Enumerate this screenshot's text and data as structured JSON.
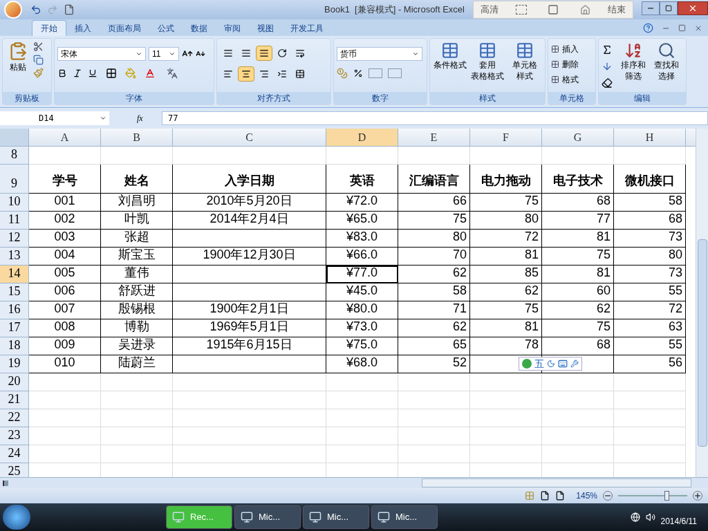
{
  "title_bar": {
    "title": "Book1  [兼容模式] - Microsoft Excel",
    "recorder_hd": "高清",
    "recorder_end": "结束"
  },
  "ribbon_tabs": [
    {
      "label": "开始",
      "selected": true
    },
    {
      "label": "插入",
      "selected": false
    },
    {
      "label": "页面布局",
      "selected": false
    },
    {
      "label": "公式",
      "selected": false
    },
    {
      "label": "数据",
      "selected": false
    },
    {
      "label": "审阅",
      "selected": false
    },
    {
      "label": "视图",
      "selected": false
    },
    {
      "label": "开发工具",
      "selected": false
    }
  ],
  "clipboard": {
    "paste": "粘贴",
    "label": "剪贴板"
  },
  "font": {
    "name": "宋体",
    "size": "11",
    "label": "字体"
  },
  "alignment": {
    "label": "对齐方式",
    "vertical": [
      {
        "selected": false
      },
      {
        "selected": false
      },
      {
        "selected": true
      }
    ],
    "horizontal": [
      {
        "selected": false
      },
      {
        "selected": true
      },
      {
        "selected": false
      }
    ]
  },
  "number": {
    "format": "货币",
    "label": "数字"
  },
  "styles": {
    "label": "样式",
    "buttons": [
      {
        "line1": "条件格式"
      },
      {
        "line1": "套用",
        "line2": "表格格式"
      },
      {
        "line1": "单元格",
        "line2": "样式"
      }
    ]
  },
  "cells": {
    "label": "单元格",
    "buttons": [
      "插入",
      "删除",
      "格式"
    ]
  },
  "editing": {
    "label": "编辑",
    "buttons": [
      {
        "line1": "排序和",
        "line2": "筛选"
      },
      {
        "line1": "查找和",
        "line2": "选择"
      }
    ]
  },
  "formula_bar": {
    "name_box": "D14",
    "fx": "fx",
    "formula": "77"
  },
  "columns": [
    {
      "label": "A",
      "selected": false
    },
    {
      "label": "B",
      "selected": false
    },
    {
      "label": "C",
      "selected": false
    },
    {
      "label": "D",
      "selected": true
    },
    {
      "label": "E",
      "selected": false
    },
    {
      "label": "F",
      "selected": false
    },
    {
      "label": "G",
      "selected": false
    },
    {
      "label": "H",
      "selected": false
    }
  ],
  "rows": [
    {
      "number": "8",
      "kind": "empty",
      "selected": false
    },
    {
      "number": "9",
      "kind": "header",
      "selected": false,
      "cells": [
        "学号",
        "姓名",
        "入学日期",
        "英语",
        "汇编语言",
        "电力拖动",
        "电子技术",
        "微机接口"
      ]
    },
    {
      "number": "10",
      "kind": "data",
      "selected": false,
      "cells": [
        "001",
        "刘昌明",
        "2010年5月20日",
        "¥72.0",
        "66",
        "75",
        "68",
        "58"
      ]
    },
    {
      "number": "11",
      "kind": "data",
      "selected": false,
      "cells": [
        "002",
        "叶凯",
        "2014年2月4日",
        "¥65.0",
        "75",
        "80",
        "77",
        "68"
      ]
    },
    {
      "number": "12",
      "kind": "data",
      "selected": false,
      "cells": [
        "003",
        "张超",
        "",
        "¥83.0",
        "80",
        "72",
        "81",
        "73"
      ]
    },
    {
      "number": "13",
      "kind": "data",
      "selected": false,
      "cells": [
        "004",
        "斯宝玉",
        "1900年12月30日",
        "¥66.0",
        "70",
        "81",
        "75",
        "80"
      ]
    },
    {
      "number": "14",
      "kind": "data",
      "selected": true,
      "cells": [
        "005",
        "董伟",
        "",
        "¥77.0",
        "62",
        "85",
        "81",
        "73"
      ]
    },
    {
      "number": "15",
      "kind": "data",
      "selected": false,
      "cells": [
        "006",
        "舒跃进",
        "",
        "¥45.0",
        "58",
        "62",
        "60",
        "55"
      ]
    },
    {
      "number": "16",
      "kind": "data",
      "selected": false,
      "cells": [
        "007",
        "殷锡根",
        "1900年2月1日",
        "¥80.0",
        "71",
        "75",
        "62",
        "72"
      ]
    },
    {
      "number": "17",
      "kind": "data",
      "selected": false,
      "cells": [
        "008",
        "博勒",
        "1969年5月1日",
        "¥73.0",
        "62",
        "81",
        "75",
        "63"
      ]
    },
    {
      "number": "18",
      "kind": "data",
      "selected": false,
      "cells": [
        "009",
        "吴进录",
        "1915年6月15日",
        "¥75.0",
        "65",
        "78",
        "68",
        "55"
      ]
    },
    {
      "number": "19",
      "kind": "data",
      "selected": false,
      "cells": [
        "010",
        "陆蔚兰",
        "",
        "¥68.0",
        "52",
        "",
        "",
        "56"
      ]
    },
    {
      "number": "20",
      "kind": "empty",
      "selected": false
    },
    {
      "number": "21",
      "kind": "empty",
      "selected": false
    },
    {
      "number": "22",
      "kind": "empty",
      "selected": false
    },
    {
      "number": "23",
      "kind": "empty",
      "selected": false
    },
    {
      "number": "24",
      "kind": "empty",
      "selected": false
    },
    {
      "number": "25",
      "kind": "empty",
      "selected": false
    }
  ],
  "ime_toolbar": {
    "mode": "五"
  },
  "status_bar": {
    "zoom": "145%",
    "zoom_slider": {
      "level": 0.7
    }
  },
  "taskbar": {
    "buttons": [
      "Rec...",
      "Mic...",
      "Mic...",
      "Mic..."
    ],
    "clock": "2014/6/11"
  }
}
